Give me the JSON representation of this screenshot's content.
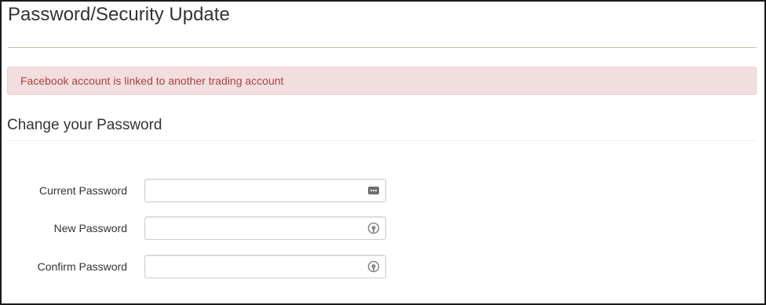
{
  "page": {
    "title": "Password/Security Update"
  },
  "alert": {
    "message": "Facebook account is linked to another trading account",
    "color": "#a94442",
    "background": "#f2dede"
  },
  "form": {
    "section_title": "Change your Password",
    "fields": [
      {
        "label": "Current Password",
        "value": "",
        "icon": "password-dots-icon"
      },
      {
        "label": "New Password",
        "value": "",
        "icon": "password-manager-icon"
      },
      {
        "label": "Confirm Password",
        "value": "",
        "icon": "password-manager-icon"
      }
    ]
  }
}
